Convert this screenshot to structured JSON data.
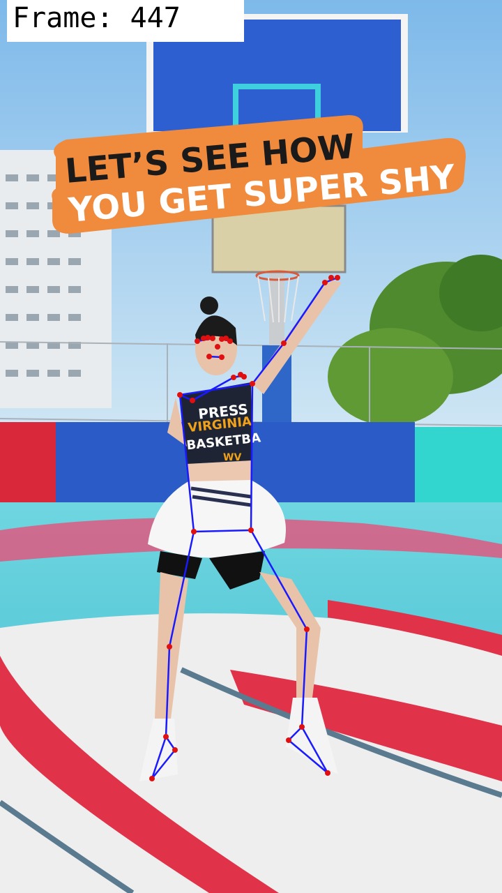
{
  "overlay": {
    "frame_label": "Frame: 447",
    "banner_line1": "LET’S SEE HOW",
    "banner_line2": "YOU GET SUPER SHY"
  },
  "shirt": {
    "line1": "PRESS",
    "line2": "VIRGINIA",
    "line3": "BASKETBA",
    "logo": "WV"
  },
  "colors": {
    "sky": "#8ec3ea",
    "banner": "#f08a3c",
    "skeleton_line": "#1a1aff",
    "keypoint": "#e01010",
    "court_cyan": "#42c7d9",
    "court_red": "#e0334a",
    "wall_blue": "#2a5bc6"
  },
  "icons": [
    "keypoint-dot",
    "pose-skeleton"
  ]
}
